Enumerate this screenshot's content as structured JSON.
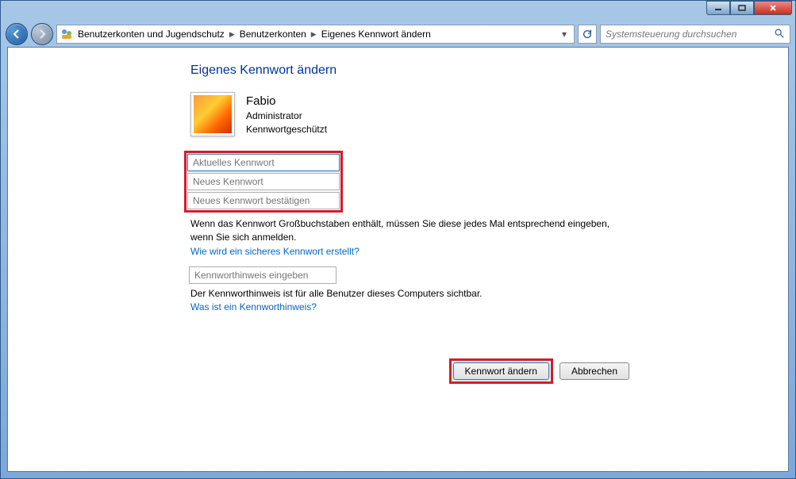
{
  "breadcrumb": {
    "items": [
      "Benutzerkonten und Jugendschutz",
      "Benutzerkonten",
      "Eigenes Kennwort ändern"
    ]
  },
  "search": {
    "placeholder": "Systemsteuerung durchsuchen"
  },
  "page": {
    "title": "Eigenes Kennwort ändern"
  },
  "user": {
    "name": "Fabio",
    "role": "Administrator",
    "status": "Kennwortgeschützt"
  },
  "fields": {
    "current_password": {
      "placeholder": "Aktuelles Kennwort"
    },
    "new_password": {
      "placeholder": "Neues Kennwort"
    },
    "confirm_password": {
      "placeholder": "Neues Kennwort bestätigen"
    },
    "hint": {
      "placeholder": "Kennworthinweis eingeben"
    }
  },
  "text": {
    "caps_warning": "Wenn das Kennwort Großbuchstaben enthält, müssen Sie diese jedes Mal entsprechend eingeben, wenn Sie sich anmelden.",
    "secure_link": "Wie wird ein sicheres Kennwort erstellt?",
    "hint_note": "Der Kennworthinweis ist für alle Benutzer dieses Computers sichtbar.",
    "hint_link": "Was ist ein Kennworthinweis?"
  },
  "buttons": {
    "change": "Kennwort ändern",
    "cancel": "Abbrechen"
  }
}
